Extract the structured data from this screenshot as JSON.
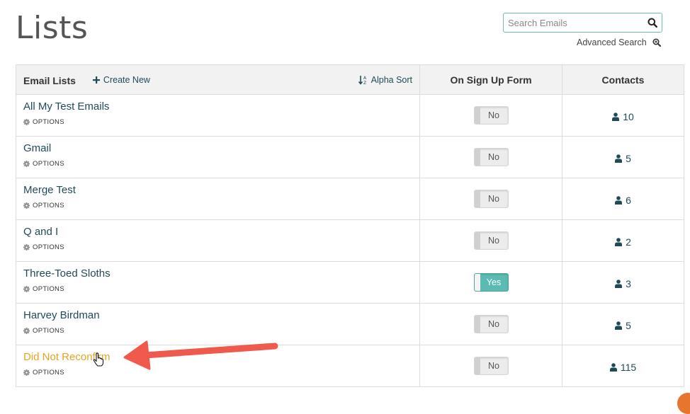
{
  "page": {
    "title": "Lists"
  },
  "search": {
    "placeholder": "Search Emails",
    "advanced_label": "Advanced Search"
  },
  "table": {
    "headers": {
      "email_lists": "Email Lists",
      "create_new": "Create New",
      "alpha_sort": "Alpha Sort",
      "on_sign_up_form": "On Sign Up Form",
      "contacts": "Contacts"
    },
    "options_label": "OPTIONS",
    "rows": [
      {
        "name": "All My Test Emails",
        "sign_up": "No",
        "contacts": "10"
      },
      {
        "name": "Gmail",
        "sign_up": "No",
        "contacts": "5"
      },
      {
        "name": "Merge Test",
        "sign_up": "No",
        "contacts": "6"
      },
      {
        "name": "Q and I",
        "sign_up": "No",
        "contacts": "2"
      },
      {
        "name": "Three-Toed Sloths",
        "sign_up": "Yes",
        "contacts": "3"
      },
      {
        "name": "Harvey Birdman",
        "sign_up": "No",
        "contacts": "5"
      },
      {
        "name": "Did Not Reconfirm",
        "sign_up": "No",
        "contacts": "115"
      }
    ]
  },
  "colors": {
    "link": "#1f4a57",
    "hover_link": "#e8a320",
    "toggle_on": "#5bbab1",
    "arrow": "#ef5a4c"
  },
  "icons": {
    "search": "magnifier-icon",
    "advanced_search": "zoom-in-icon",
    "create_new": "plus-icon",
    "alpha_sort": "sort-alpha-icon",
    "options": "gear-icon",
    "contacts": "user-icon"
  }
}
